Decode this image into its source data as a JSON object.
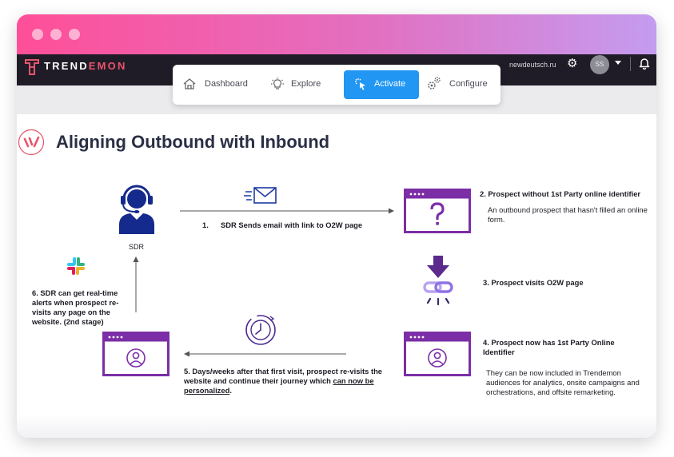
{
  "nav": {
    "brand_prefix": "TREND",
    "brand_suffix": "EMON",
    "domain": "newdeutsch.ru",
    "avatar_initials": "SS",
    "tabs": [
      {
        "label": "Dashboard",
        "icon": "home-icon",
        "active": false
      },
      {
        "label": "Explore",
        "icon": "lightbulb-icon",
        "active": false
      },
      {
        "label": "Activate",
        "icon": "cursor-click-icon",
        "active": true
      },
      {
        "label": "Configure",
        "icon": "gears-icon",
        "active": false
      }
    ]
  },
  "page": {
    "title": "Aligning Outbound with Inbound"
  },
  "diagram": {
    "sdr_label": "SDR",
    "step1": {
      "num": "1.",
      "text": "SDR Sends email with link to O2W page"
    },
    "step2": {
      "title": "2. Prospect without 1st Party online identifier",
      "desc": "An outbound prospect that hasn't filled an online form."
    },
    "step3": {
      "title": "3. Prospect visits O2W page"
    },
    "step4": {
      "title": "4. Prospect now has 1st Party Online Identifier",
      "desc": "They can be now included in Trendemon audiences for analytics, onsite campaigns and orchestrations, and offsite remarketing."
    },
    "step5": {
      "text_a": "5. Days/weeks after that first visit, prospect re-visits the website and continue their journey which ",
      "text_link": "can now be personalized",
      "text_end": "."
    },
    "step6": {
      "text": "6. SDR can get real-time alerts when prospect re-visits any page on the website. (2nd stage)"
    }
  },
  "colors": {
    "accent_purple": "#7c2ea6",
    "title_bar_start": "#ff4f98",
    "title_bar_end": "#c49cf0",
    "navbar": "#1f1c27",
    "active_tab": "#2196f3",
    "brand_red": "#e8546b",
    "sdr_navy": "#142a8c",
    "link_purple": "#4b2a8f"
  }
}
